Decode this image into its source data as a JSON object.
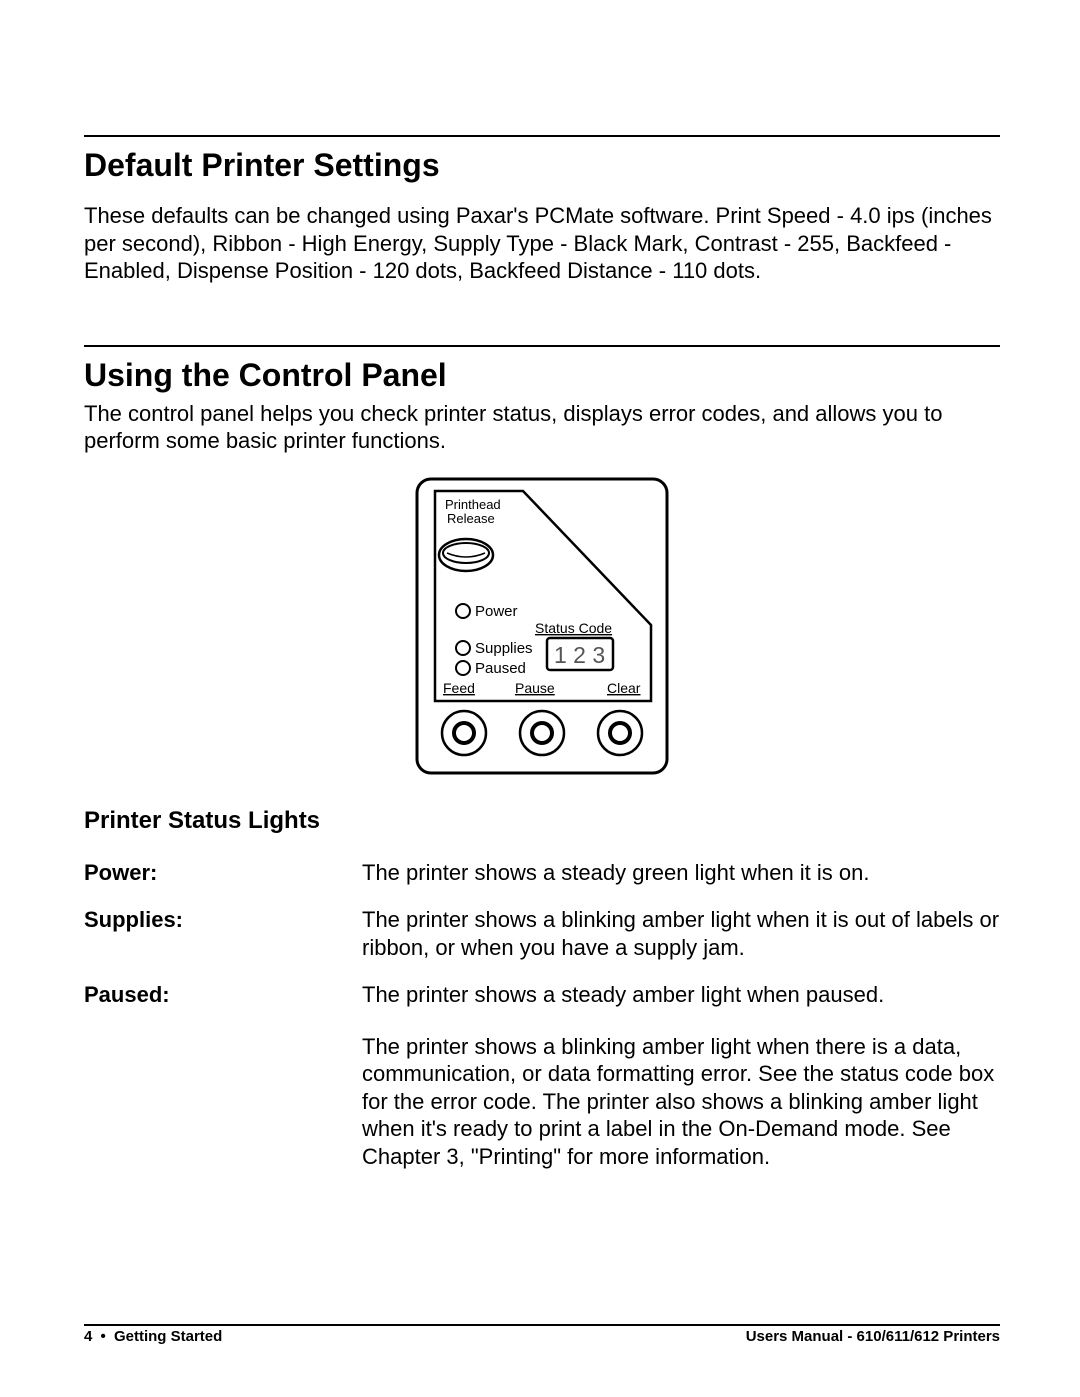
{
  "section1": {
    "title": "Default Printer Settings",
    "body": "These defaults can be changed using Paxar's PCMate software.  Print Speed - 4.0 ips (inches per second), Ribbon - High Energy, Supply Type - Black Mark, Contrast - 255, Backfeed - Enabled, Dispense Position - 120 dots, Backfeed Distance - 110 dots."
  },
  "section2": {
    "title": "Using the Control Panel",
    "intro": "The control panel helps you check printer status, displays error codes, and allows you to perform some basic printer functions."
  },
  "panel": {
    "printhead": "Printhead",
    "release": "Release",
    "power": "Power",
    "status_code": "Status Code",
    "supplies": "Supplies",
    "paused": "Paused",
    "code": "1 2 3",
    "feed": "Feed",
    "pause": "Pause",
    "clear": "Clear"
  },
  "status": {
    "heading": "Printer Status Lights",
    "rows": [
      {
        "term": "Power:",
        "def": "The printer shows a steady green light when it is on."
      },
      {
        "term": "Supplies:",
        "def": "The printer shows a blinking amber light when it is out of labels or ribbon, or when you have a supply jam."
      },
      {
        "term": "Paused:",
        "def": "The printer shows a steady amber light when paused."
      }
    ],
    "extra": "The printer shows a blinking amber light when there is a data, communication, or data formatting error.  See the status code box for the error code.  The printer also shows a blinking amber light when it's ready to print a label in the On-Demand mode.  See Chapter 3, \"Printing\" for more information."
  },
  "footer": {
    "page": "4",
    "bullet": "•",
    "chapter": "Getting Started",
    "manual": "Users Manual - 610/611/612 Printers"
  }
}
